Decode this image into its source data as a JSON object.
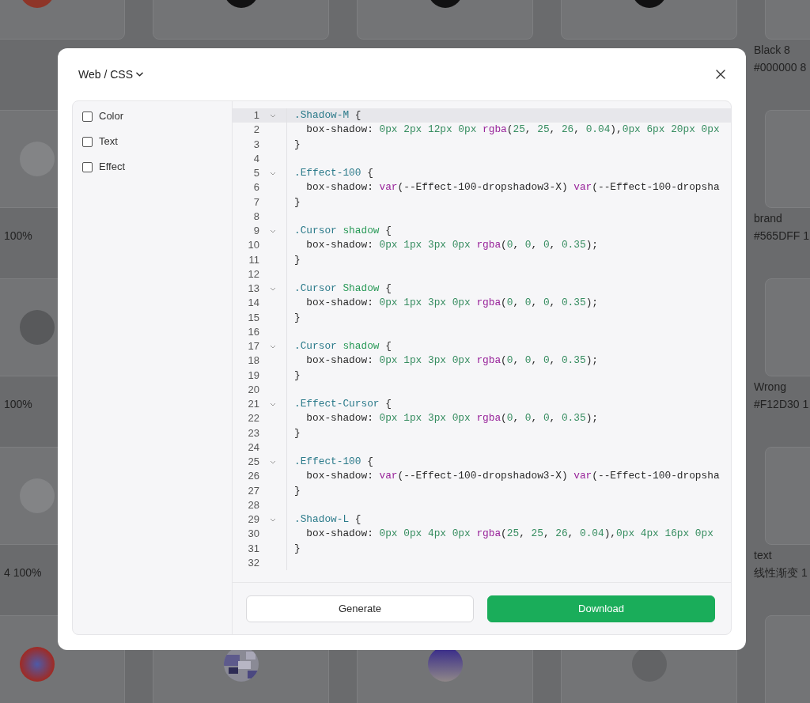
{
  "background": {
    "rows": [
      {
        "cells": [
          {
            "swatch": {
              "kind": "solid",
              "color": "#8e3528"
            }
          },
          {
            "swatch": {
              "kind": "solid",
              "color": "#111112"
            }
          },
          {
            "swatch": {
              "kind": "solid",
              "color": "#111112"
            }
          },
          {
            "swatch": {
              "kind": "solid",
              "color": "#111112"
            }
          },
          {
            "name": "Black 8",
            "value": "#000000 8"
          }
        ]
      },
      {
        "cells": [
          {
            "swatch": {
              "kind": "solid",
              "color": "#838486"
            },
            "value": "100%"
          },
          {},
          {},
          {},
          {
            "name": "brand",
            "value": "#565DFF 1"
          }
        ]
      },
      {
        "cells": [
          {
            "swatch": {
              "kind": "solid",
              "color": "#58595b"
            },
            "value": "100%"
          },
          {},
          {},
          {},
          {
            "name": "Wrong",
            "value": "#F12D30 1"
          }
        ]
      },
      {
        "cells": [
          {
            "swatch": {
              "kind": "solid",
              "color": "#838486"
            },
            "value": "4 100%"
          },
          {},
          {},
          {},
          {
            "name": "text",
            "value": "线性渐变 1"
          }
        ]
      },
      {
        "cells": [
          {
            "swatch": {
              "kind": "radial"
            }
          },
          {
            "swatch": {
              "kind": "picture"
            }
          },
          {
            "swatch": {
              "kind": "fade"
            }
          },
          {
            "swatch": {
              "kind": "solid",
              "color": "#626365"
            }
          },
          {}
        ]
      }
    ]
  },
  "dialog": {
    "format_menu": "Web / CSS",
    "filters": [
      {
        "label": "Color",
        "checked": false
      },
      {
        "label": "Text",
        "checked": false
      },
      {
        "label": "Effect",
        "checked": false
      }
    ],
    "code": {
      "lines": [
        {
          "number": "1",
          "foldable": true,
          "highlighted": true,
          "tokens": [
            {
              "kind": "class",
              "text": ".Shadow-M"
            },
            {
              "kind": "plain",
              "text": " {"
            }
          ]
        },
        {
          "number": "2",
          "foldable": false,
          "highlighted": false,
          "tokens": [
            {
              "kind": "plain",
              "text": "  box-shadow: "
            },
            {
              "kind": "number",
              "text": "0px 2px 12px 0px "
            },
            {
              "kind": "func",
              "text": "rgba"
            },
            {
              "kind": "plain",
              "text": "("
            },
            {
              "kind": "number",
              "text": "25"
            },
            {
              "kind": "plain",
              "text": ", "
            },
            {
              "kind": "number",
              "text": "25"
            },
            {
              "kind": "plain",
              "text": ", "
            },
            {
              "kind": "number",
              "text": "26"
            },
            {
              "kind": "plain",
              "text": ", "
            },
            {
              "kind": "number",
              "text": "0.04"
            },
            {
              "kind": "plain",
              "text": "),"
            },
            {
              "kind": "number",
              "text": "0px 6px 20px 0px"
            }
          ]
        },
        {
          "number": "3",
          "foldable": false,
          "highlighted": false,
          "tokens": [
            {
              "kind": "plain",
              "text": "}"
            }
          ]
        },
        {
          "number": "4",
          "foldable": false,
          "highlighted": false
        },
        {
          "number": "5",
          "foldable": true,
          "highlighted": false,
          "tokens": [
            {
              "kind": "class",
              "text": ".Effect-100"
            },
            {
              "kind": "plain",
              "text": " {"
            }
          ]
        },
        {
          "number": "6",
          "foldable": false,
          "highlighted": false,
          "tokens": [
            {
              "kind": "plain",
              "text": "  box-shadow: "
            },
            {
              "kind": "func",
              "text": "var"
            },
            {
              "kind": "plain",
              "text": "(--Effect-100-dropshadow3-X) "
            },
            {
              "kind": "func",
              "text": "var"
            },
            {
              "kind": "plain",
              "text": "(--Effect-100-dropsha"
            }
          ]
        },
        {
          "number": "7",
          "foldable": false,
          "highlighted": false,
          "tokens": [
            {
              "kind": "plain",
              "text": "}"
            }
          ]
        },
        {
          "number": "8",
          "foldable": false,
          "highlighted": false
        },
        {
          "number": "9",
          "foldable": true,
          "highlighted": false,
          "tokens": [
            {
              "kind": "class",
              "text": ".Cursor "
            },
            {
              "kind": "tag",
              "text": "shadow"
            },
            {
              "kind": "plain",
              "text": " {"
            }
          ]
        },
        {
          "number": "10",
          "foldable": false,
          "highlighted": false,
          "tokens": [
            {
              "kind": "plain",
              "text": "  box-shadow: "
            },
            {
              "kind": "number",
              "text": "0px 1px 3px 0px "
            },
            {
              "kind": "func",
              "text": "rgba"
            },
            {
              "kind": "plain",
              "text": "("
            },
            {
              "kind": "number",
              "text": "0"
            },
            {
              "kind": "plain",
              "text": ", "
            },
            {
              "kind": "number",
              "text": "0"
            },
            {
              "kind": "plain",
              "text": ", "
            },
            {
              "kind": "number",
              "text": "0"
            },
            {
              "kind": "plain",
              "text": ", "
            },
            {
              "kind": "number",
              "text": "0.35"
            },
            {
              "kind": "plain",
              "text": ");"
            }
          ]
        },
        {
          "number": "11",
          "foldable": false,
          "highlighted": false,
          "tokens": [
            {
              "kind": "plain",
              "text": "}"
            }
          ]
        },
        {
          "number": "12",
          "foldable": false,
          "highlighted": false
        },
        {
          "number": "13",
          "foldable": true,
          "highlighted": false,
          "tokens": [
            {
              "kind": "class",
              "text": ".Cursor "
            },
            {
              "kind": "tag",
              "text": "Shadow"
            },
            {
              "kind": "plain",
              "text": " {"
            }
          ]
        },
        {
          "number": "14",
          "foldable": false,
          "highlighted": false,
          "tokens": [
            {
              "kind": "plain",
              "text": "  box-shadow: "
            },
            {
              "kind": "number",
              "text": "0px 1px 3px 0px "
            },
            {
              "kind": "func",
              "text": "rgba"
            },
            {
              "kind": "plain",
              "text": "("
            },
            {
              "kind": "number",
              "text": "0"
            },
            {
              "kind": "plain",
              "text": ", "
            },
            {
              "kind": "number",
              "text": "0"
            },
            {
              "kind": "plain",
              "text": ", "
            },
            {
              "kind": "number",
              "text": "0"
            },
            {
              "kind": "plain",
              "text": ", "
            },
            {
              "kind": "number",
              "text": "0.35"
            },
            {
              "kind": "plain",
              "text": ");"
            }
          ]
        },
        {
          "number": "15",
          "foldable": false,
          "highlighted": false,
          "tokens": [
            {
              "kind": "plain",
              "text": "}"
            }
          ]
        },
        {
          "number": "16",
          "foldable": false,
          "highlighted": false
        },
        {
          "number": "17",
          "foldable": true,
          "highlighted": false,
          "tokens": [
            {
              "kind": "class",
              "text": ".Cursor "
            },
            {
              "kind": "tag",
              "text": "shadow"
            },
            {
              "kind": "plain",
              "text": " {"
            }
          ]
        },
        {
          "number": "18",
          "foldable": false,
          "highlighted": false,
          "tokens": [
            {
              "kind": "plain",
              "text": "  box-shadow: "
            },
            {
              "kind": "number",
              "text": "0px 1px 3px 0px "
            },
            {
              "kind": "func",
              "text": "rgba"
            },
            {
              "kind": "plain",
              "text": "("
            },
            {
              "kind": "number",
              "text": "0"
            },
            {
              "kind": "plain",
              "text": ", "
            },
            {
              "kind": "number",
              "text": "0"
            },
            {
              "kind": "plain",
              "text": ", "
            },
            {
              "kind": "number",
              "text": "0"
            },
            {
              "kind": "plain",
              "text": ", "
            },
            {
              "kind": "number",
              "text": "0.35"
            },
            {
              "kind": "plain",
              "text": ");"
            }
          ]
        },
        {
          "number": "19",
          "foldable": false,
          "highlighted": false,
          "tokens": [
            {
              "kind": "plain",
              "text": "}"
            }
          ]
        },
        {
          "number": "20",
          "foldable": false,
          "highlighted": false
        },
        {
          "number": "21",
          "foldable": true,
          "highlighted": false,
          "tokens": [
            {
              "kind": "class",
              "text": ".Effect-Cursor"
            },
            {
              "kind": "plain",
              "text": " {"
            }
          ]
        },
        {
          "number": "22",
          "foldable": false,
          "highlighted": false,
          "tokens": [
            {
              "kind": "plain",
              "text": "  box-shadow: "
            },
            {
              "kind": "number",
              "text": "0px 1px 3px 0px "
            },
            {
              "kind": "func",
              "text": "rgba"
            },
            {
              "kind": "plain",
              "text": "("
            },
            {
              "kind": "number",
              "text": "0"
            },
            {
              "kind": "plain",
              "text": ", "
            },
            {
              "kind": "number",
              "text": "0"
            },
            {
              "kind": "plain",
              "text": ", "
            },
            {
              "kind": "number",
              "text": "0"
            },
            {
              "kind": "plain",
              "text": ", "
            },
            {
              "kind": "number",
              "text": "0.35"
            },
            {
              "kind": "plain",
              "text": ");"
            }
          ]
        },
        {
          "number": "23",
          "foldable": false,
          "highlighted": false,
          "tokens": [
            {
              "kind": "plain",
              "text": "}"
            }
          ]
        },
        {
          "number": "24",
          "foldable": false,
          "highlighted": false
        },
        {
          "number": "25",
          "foldable": true,
          "highlighted": false,
          "tokens": [
            {
              "kind": "class",
              "text": ".Effect-100"
            },
            {
              "kind": "plain",
              "text": " {"
            }
          ]
        },
        {
          "number": "26",
          "foldable": false,
          "highlighted": false,
          "tokens": [
            {
              "kind": "plain",
              "text": "  box-shadow: "
            },
            {
              "kind": "func",
              "text": "var"
            },
            {
              "kind": "plain",
              "text": "(--Effect-100-dropshadow3-X) "
            },
            {
              "kind": "func",
              "text": "var"
            },
            {
              "kind": "plain",
              "text": "(--Effect-100-dropsha"
            }
          ]
        },
        {
          "number": "27",
          "foldable": false,
          "highlighted": false,
          "tokens": [
            {
              "kind": "plain",
              "text": "}"
            }
          ]
        },
        {
          "number": "28",
          "foldable": false,
          "highlighted": false
        },
        {
          "number": "29",
          "foldable": true,
          "highlighted": false,
          "tokens": [
            {
              "kind": "class",
              "text": ".Shadow-L"
            },
            {
              "kind": "plain",
              "text": " {"
            }
          ]
        },
        {
          "number": "30",
          "foldable": false,
          "highlighted": false,
          "tokens": [
            {
              "kind": "plain",
              "text": "  box-shadow: "
            },
            {
              "kind": "number",
              "text": "0px 0px 4px 0px "
            },
            {
              "kind": "func",
              "text": "rgba"
            },
            {
              "kind": "plain",
              "text": "("
            },
            {
              "kind": "number",
              "text": "25"
            },
            {
              "kind": "plain",
              "text": ", "
            },
            {
              "kind": "number",
              "text": "25"
            },
            {
              "kind": "plain",
              "text": ", "
            },
            {
              "kind": "number",
              "text": "26"
            },
            {
              "kind": "plain",
              "text": ", "
            },
            {
              "kind": "number",
              "text": "0.04"
            },
            {
              "kind": "plain",
              "text": "),"
            },
            {
              "kind": "number",
              "text": "0px 4px 16px 0px"
            }
          ]
        },
        {
          "number": "31",
          "foldable": false,
          "highlighted": false,
          "tokens": [
            {
              "kind": "plain",
              "text": "}"
            }
          ]
        },
        {
          "number": "32",
          "foldable": false,
          "highlighted": false
        }
      ]
    },
    "buttons": [
      {
        "label": "Generate",
        "kind": "secondary"
      },
      {
        "label": "Download",
        "kind": "primary"
      }
    ]
  }
}
